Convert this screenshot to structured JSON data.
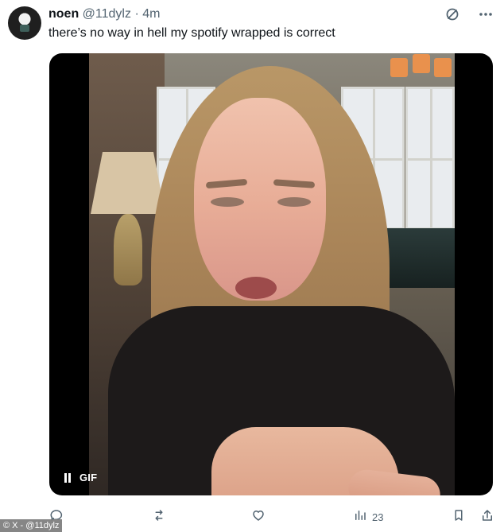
{
  "tweet": {
    "display_name": "noen",
    "handle": "@11dylz",
    "separator": "·",
    "time": "4m",
    "text": "there’s no way in hell my spotify wrapped is correct"
  },
  "media": {
    "gif_label": "GIF",
    "playback_state": "playing"
  },
  "actions": {
    "reply_count": "",
    "repost_count": "",
    "like_count": "",
    "view_count": "23",
    "bookmark_count": "",
    "share_count": ""
  },
  "overlay": {
    "watermark": "© X - @11dylz"
  },
  "icons": {
    "top_right": [
      "grok-icon",
      "more-options-icon"
    ],
    "media": [
      "pause-icon"
    ],
    "bottom": [
      "reply-icon",
      "repost-icon",
      "like-icon",
      "views-icon",
      "bookmark-icon",
      "share-icon"
    ]
  },
  "colors": {
    "text_primary": "#0f1419",
    "text_secondary": "#536471",
    "media_background": "#000000",
    "watermark_background": "#7f7f7f"
  }
}
